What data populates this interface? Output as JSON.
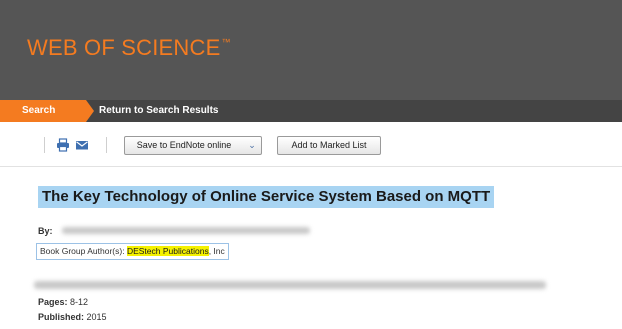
{
  "brand": {
    "name": "WEB OF SCIENCE",
    "trademark": "™"
  },
  "tabs": {
    "search": "Search",
    "return": "Return to Search Results"
  },
  "toolbar": {
    "save_label": "Save to EndNote online",
    "add_label": "Add to Marked List",
    "icons": [
      "print-icon",
      "email-icon",
      "dropdown-arrow-icon"
    ]
  },
  "record": {
    "title": "The Key Technology of Online Service System Based on MQTT",
    "by_label": "By:",
    "group_author_label": "Book Group Author(s):",
    "group_author_highlight": "DEStech Publications",
    "group_author_rest": ", Inc",
    "pages_label": "Pages:",
    "pages_value": "8-12",
    "published_label": "Published:",
    "published_value": "2015"
  },
  "colors": {
    "header_bg": "#555555",
    "tabbar_bg": "#444444",
    "accent": "#f47b20",
    "title_highlight": "#a8d4f2",
    "text_highlight": "#f5f200"
  }
}
